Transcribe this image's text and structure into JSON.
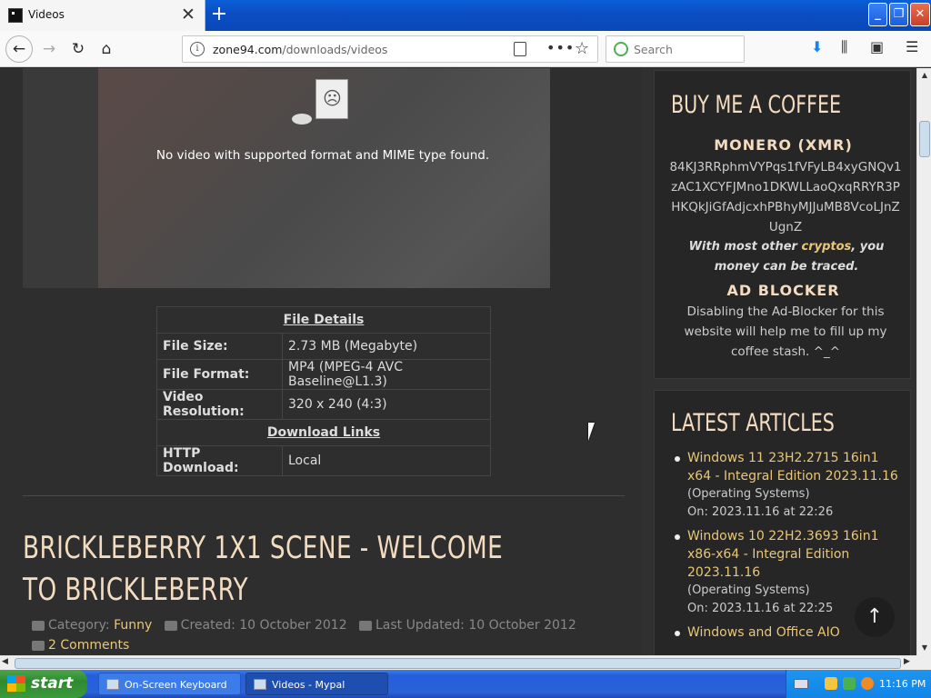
{
  "browser": {
    "tab_title": "Videos",
    "url_host": "zone94.com",
    "url_path": "/downloads/videos",
    "search_placeholder": "Search"
  },
  "video": {
    "error_message": "No video with supported format and MIME type found."
  },
  "details": {
    "file_details_header": "File Details",
    "rows": [
      {
        "key": "File Size:",
        "value": "2.73 MB (Megabyte)"
      },
      {
        "key": "File Format:",
        "value": "MP4 (MPEG-4 AVC Baseline@L1.3)"
      },
      {
        "key": "Video Resolution:",
        "value": "320 x 240 (4:3)"
      }
    ],
    "download_header": "Download Links",
    "download_key": "HTTP Download:",
    "download_value": "Local"
  },
  "article": {
    "title": "BRICKLEBERRY 1X1 SCENE - WELCOME TO BRICKLEBERRY",
    "category_label": "Category:",
    "category": "Funny",
    "created": "Created: 10 October 2012",
    "updated": "Last Updated: 10 October 2012",
    "comments": "2 Comments"
  },
  "sidebar": {
    "coffee_title": "BUY ME A COFFEE",
    "monero_header": "MONERO (XMR)",
    "monero_address": "84KJ3RRphmVYPqs1fVFyLB4xyGNQv1zAC1XCYFJMno1DKWLLaoQxqRRYR3PHKQkJiGfAdjcxhPBhyMJJuMB8VcoLJnZUgnZ",
    "crypto_note_pre": "With most other",
    "crypto_link": "cryptos",
    "crypto_note_post": ", you money can be traced.",
    "adblock_header": "AD BLOCKER",
    "adblock_text": "Disabling the Ad-Blocker for this website will help me to fill up my coffee stash. ^_^",
    "latest_title": "LATEST ARTICLES",
    "articles": [
      {
        "title": "Windows 11 23H2.2715 16in1 x64 - Integral Edition 2023.11.16",
        "category": "(Operating Systems)",
        "date": "On: 2023.11.16 at 22:26"
      },
      {
        "title": "Windows 10 22H2.3693 16in1 x86-x64 - Integral Edition 2023.11.16",
        "category": "(Operating Systems)",
        "date": "On: 2023.11.16 at 22:25"
      },
      {
        "title": "Windows and Office AIO",
        "category": "",
        "date": ""
      }
    ]
  },
  "taskbar": {
    "start_label": "start",
    "tasks": [
      "On-Screen Keyboard",
      "Videos - Mypal"
    ],
    "clock": "11:16 PM"
  }
}
